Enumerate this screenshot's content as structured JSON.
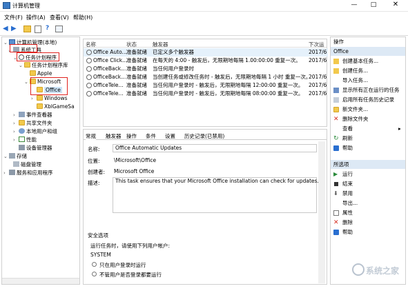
{
  "window": {
    "title": "计算机管理"
  },
  "menu": [
    "文件(F)",
    "操作(A)",
    "查看(V)",
    "帮助(H)"
  ],
  "tree": {
    "root": "计算机管理(本地)",
    "system_tools": "系统工具",
    "task_scheduler": "任务计划程序",
    "task_library": "任务计划程序库",
    "apple": "Apple",
    "microsoft": "Microsoft",
    "office": "Office",
    "windows": "Windows",
    "xblgamesave": "XblGameSa",
    "event_viewer": "事件查看器",
    "shared_folders": "共享文件夹",
    "local_users": "本地用户和组",
    "performance": "性能",
    "device_manager": "设备管理器",
    "storage": "存储",
    "disk_mgmt": "磁盘管理",
    "services_apps": "服务和应用程序"
  },
  "task_list": {
    "headers": {
      "name": "名称",
      "status": "状态",
      "trigger": "触发器",
      "next": "下次运"
    },
    "rows": [
      {
        "name": "Office Auto...",
        "status": "准备就绪",
        "trigger": "已定义多个触发器",
        "next": "2017/6"
      },
      {
        "name": "Office Click...",
        "status": "准备就绪",
        "trigger": "在每天的 4:00 - 触发后，无限期地每隔 1.00:00:00 重复一次。",
        "next": "2017/6"
      },
      {
        "name": "OfficeBack...",
        "status": "准备就绪",
        "trigger": "当任何用户登录时",
        "next": ""
      },
      {
        "name": "OfficeBack...",
        "status": "准备就绪",
        "trigger": "当创建任务或修改任务时 - 触发后，无限期地每隔 1 小时 重复一次。",
        "next": "2017/6"
      },
      {
        "name": "OfficeTele...",
        "status": "准备就绪",
        "trigger": "当任何用户登录时 - 触发后，无限期地每隔 12:00:00 重复一次。",
        "next": "2017/6"
      },
      {
        "name": "OfficeTele...",
        "status": "准备就绪",
        "trigger": "当任何用户登录时 - 触发后，无限期地每隔 08:00:00 重复一次。",
        "next": "2017/6"
      }
    ]
  },
  "detail": {
    "tabs": [
      "常规",
      "触发器",
      "操作",
      "条件",
      "设置",
      "历史记录(已禁用)"
    ],
    "name_label": "名称:",
    "name_value": "Office Automatic Updates",
    "location_label": "位置:",
    "location_value": "\\Microsoft\\Office",
    "author_label": "创建者:",
    "author_value": "Microsoft Office",
    "desc_label": "描述:",
    "desc_value": "This task ensures that your Microsoft Office installation can check for updates.",
    "security_title": "安全选项",
    "run_as_label": "运行任务时，请使用下列用户帐户:",
    "run_as_value": "SYSTEM",
    "opt1": "只在用户登录时运行",
    "opt2": "不管用户是否登录都要运行"
  },
  "actions": {
    "title": "操作",
    "section1": "Office",
    "items1": [
      "创建基本任务...",
      "创建任务...",
      "导入任务...",
      "显示所有正在运行的任务",
      "启用所有任务历史记录",
      "新文件夹...",
      "删除文件夹",
      "查看",
      "刷新",
      "帮助"
    ],
    "section2": "所选项",
    "items2": [
      "运行",
      "结束",
      "禁用",
      "导出...",
      "属性",
      "删除",
      "帮助"
    ]
  },
  "watermark": "系统之家",
  "colors": {
    "accent": "#1a6fc9",
    "highlight_box": "#e0201c",
    "selection": "#cce4f7"
  }
}
